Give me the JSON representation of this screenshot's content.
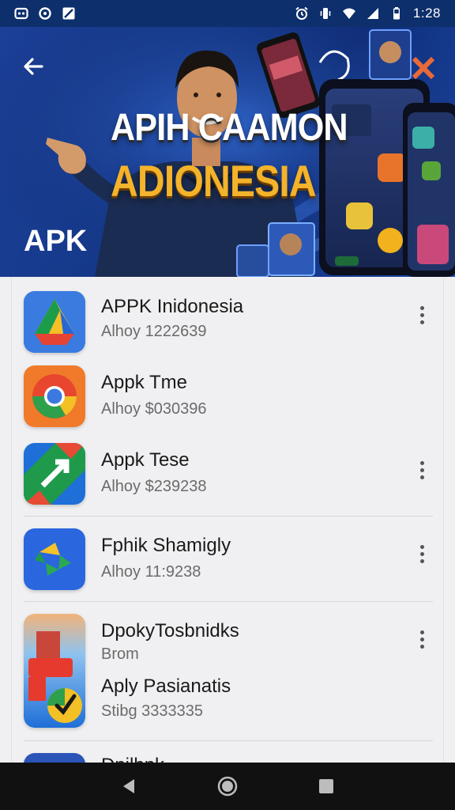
{
  "status_bar": {
    "time": "1:28",
    "left_icons": [
      "notification-box-icon",
      "notification-circle-icon",
      "gallery-icon"
    ],
    "right_icons": [
      "alarm-icon",
      "vibrate-icon",
      "wifi-icon",
      "signal-icon",
      "battery-icon"
    ]
  },
  "hero": {
    "title_line1": "APIH CAAMON",
    "title_line2": "ADIONESIA",
    "apk_label": "APK",
    "colors": {
      "title_line2": "#f3b32a",
      "background": "#163a8c"
    }
  },
  "apps": [
    {
      "name": "APPK Inidonesia",
      "subtitle": "Alhoy 1222639",
      "icon": "drive-icon"
    },
    {
      "name": "Appk Tme",
      "subtitle": "Alhoy $030396",
      "icon": "chrome-icon"
    },
    {
      "name": "Appk Tese",
      "subtitle": "Alhoy $239238",
      "icon": "green-arrow-icon"
    },
    {
      "name": "Fphik Shamigly",
      "subtitle": "Alhoy 11:9238",
      "icon": "photos-icon"
    },
    {
      "name": "DpokyTosbnidks",
      "subtitle": "Brom",
      "icon": "combined-app-icon"
    },
    {
      "name": "Aply Pasianatis",
      "subtitle": "Stibg 3333335",
      "icon": ""
    },
    {
      "name": "Dnilbnk",
      "subtitle": "",
      "icon": "blue-app-icon"
    }
  ],
  "nav": {
    "icons": [
      "back-triangle-icon",
      "home-circle-icon",
      "recents-square-icon"
    ]
  }
}
